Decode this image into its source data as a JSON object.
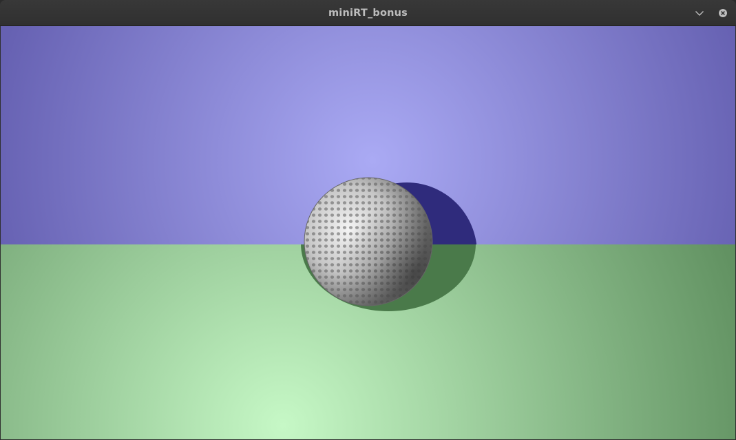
{
  "window": {
    "title": "miniRT_bonus"
  },
  "titlebar_buttons": {
    "minimize_icon": "chevron-down-icon",
    "close_icon": "close-icon"
  },
  "scene": {
    "sky_center_color": "#aaaaf4",
    "sky_edge_color": "#6661b2",
    "floor_center_color": "#c6f8c6",
    "floor_edge_color": "#5e8e5e",
    "shadow_on_wall_color": "#2f2b7c",
    "shadow_on_floor_color": "#4a7a4a",
    "sphere_color": "#bdbdbd"
  }
}
